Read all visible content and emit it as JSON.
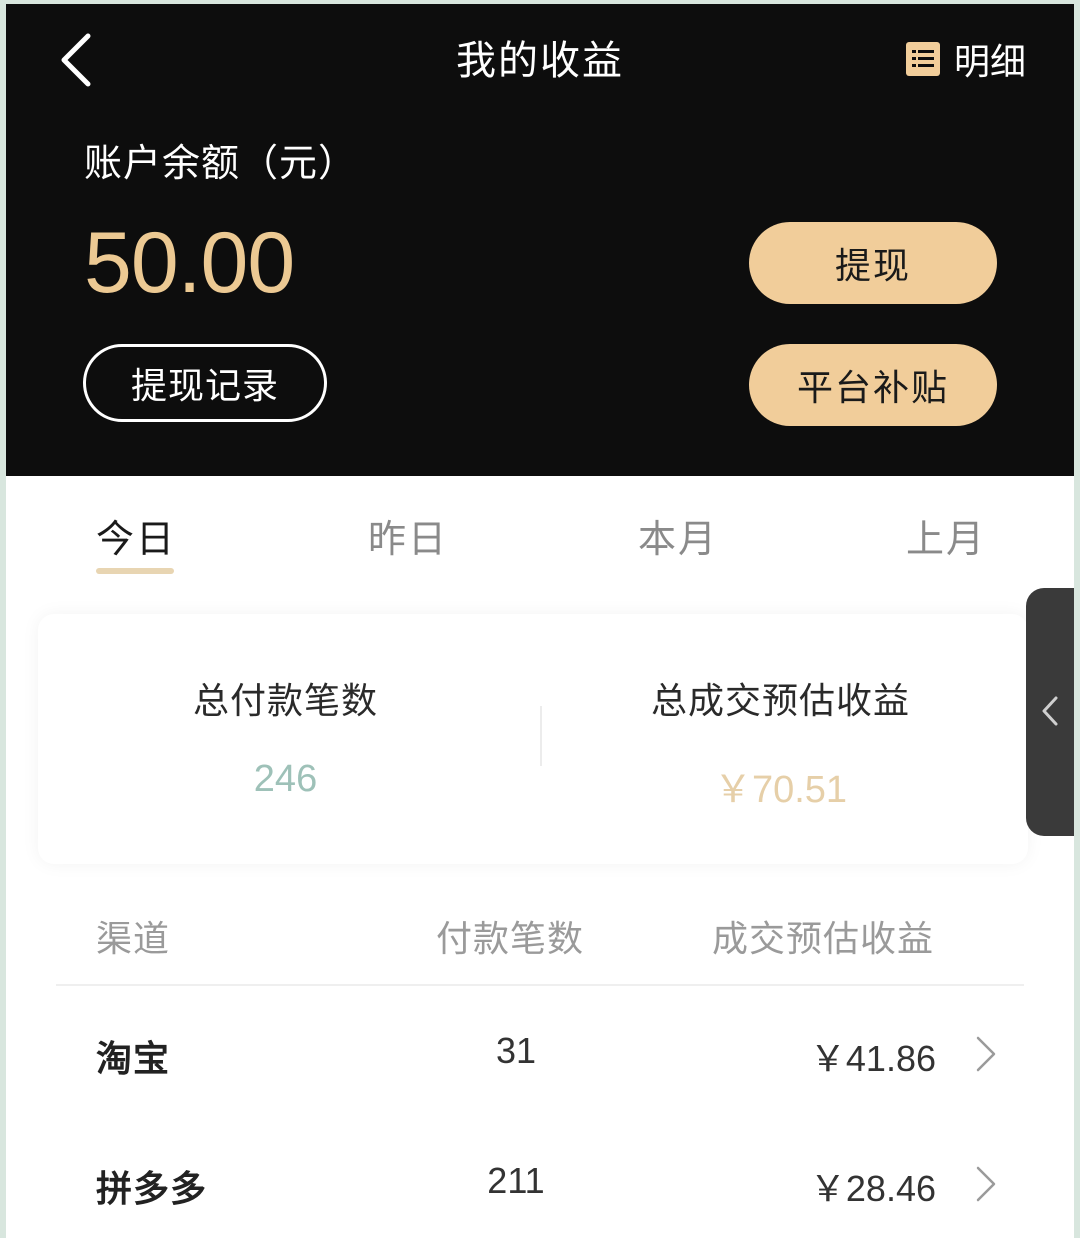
{
  "header": {
    "title": "我的收益",
    "detail_label": "明细",
    "balance_label": "账户余额（元）",
    "balance_value": "50.00",
    "withdraw_button": "提现",
    "withdraw_record_button": "提现记录",
    "subsidy_button": "平台补贴"
  },
  "tabs": [
    {
      "label": "今日",
      "active": true
    },
    {
      "label": "昨日",
      "active": false
    },
    {
      "label": "本月",
      "active": false
    },
    {
      "label": "上月",
      "active": false
    }
  ],
  "summary": {
    "payment_count_label": "总付款笔数",
    "payment_count_value": "246",
    "estimated_income_label": "总成交预估收益",
    "estimated_income_value": "￥70.51"
  },
  "table": {
    "headers": [
      "渠道",
      "付款笔数",
      "成交预估收益"
    ],
    "rows": [
      {
        "channel": "淘宝",
        "count": "31",
        "income": "￥41.86"
      },
      {
        "channel": "拼多多",
        "count": "211",
        "income": "￥28.46"
      }
    ]
  },
  "icons": {
    "back": "chevron-left-icon",
    "detail": "list-icon",
    "row": "chevron-right-icon",
    "side_handle": "chevron-left-icon"
  },
  "colors": {
    "header_bg": "#0d0d0d",
    "gold_accent": "#ecc993",
    "gold_button": "#f1cd9a",
    "count_color": "#9ec1b8"
  }
}
